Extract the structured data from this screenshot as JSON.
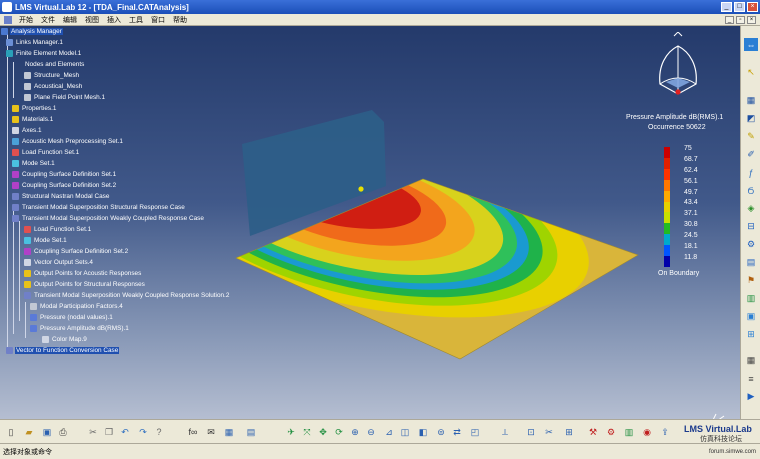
{
  "window": {
    "title": "LMS Virtual.Lab 12 - [TDA_Final.CATAnalysis]"
  },
  "menu": [
    "开始",
    "文件",
    "编辑",
    "视图",
    "插入",
    "工具",
    "窗口",
    "帮助"
  ],
  "tree": [
    {
      "label": "Analysis Manager",
      "selected": true
    },
    {
      "label": "Links Manager.1"
    },
    {
      "label": "Finite Element Model.1"
    },
    {
      "label": "Nodes and Elements"
    },
    {
      "label": "Structure_Mesh"
    },
    {
      "label": "Acoustical_Mesh"
    },
    {
      "label": "Plane Field Point Mesh.1"
    },
    {
      "label": "Properties.1"
    },
    {
      "label": "Materials.1"
    },
    {
      "label": "Axes.1"
    },
    {
      "label": "Acoustic Mesh Preprocessing Set.1"
    },
    {
      "label": "Load Function Set.1"
    },
    {
      "label": "Mode Set.1"
    },
    {
      "label": "Coupling Surface Definition Set.1"
    },
    {
      "label": "Coupling Surface Definition Set.2"
    },
    {
      "label": "Structural Nastran Modal Case"
    },
    {
      "label": "Transient Modal Superposition Structural Response Case"
    },
    {
      "label": "Transient Modal Superposition Weakly Coupled Response Case"
    },
    {
      "label": "Load Function Set.1"
    },
    {
      "label": "Mode Set.1"
    },
    {
      "label": "Coupling Surface Definition Set.2"
    },
    {
      "label": "Vector Output Sets.4"
    },
    {
      "label": "Output Points for Acoustic Responses"
    },
    {
      "label": "Output Points for Structural Responses"
    },
    {
      "label": "Transient Modal Superposition Weakly Coupled Response Solution.2"
    },
    {
      "label": "Modal Participation Factors.4"
    },
    {
      "label": "Pressure (nodal values).1"
    },
    {
      "label": "Pressure Amplitude dB(RMS).1"
    },
    {
      "label": "Color Map.9"
    },
    {
      "label": "Vector to Function Conversion Case"
    }
  ],
  "legend": {
    "title": "Pressure Amplitude dB(RMS).1",
    "occurrence": "Occurrence 50622",
    "values": [
      "75",
      "68.7",
      "62.4",
      "56.1",
      "49.7",
      "43.4",
      "37.1",
      "30.8",
      "24.5",
      "18.1",
      "11.8"
    ],
    "colors": [
      "#cc0000",
      "#e02000",
      "#ff3300",
      "#ff7700",
      "#ffaa00",
      "#e8d000",
      "#c8e000",
      "#22bb22",
      "#00aacc",
      "#0055ff",
      "#0000aa"
    ],
    "boundary_label": "On Boundary"
  },
  "branding": {
    "logo": "LMS Virtual.Lab",
    "logo_sub": "仿真科技论坛"
  },
  "status": {
    "prompt": "选择对象或命令",
    "site": "forum.simwe.com"
  }
}
